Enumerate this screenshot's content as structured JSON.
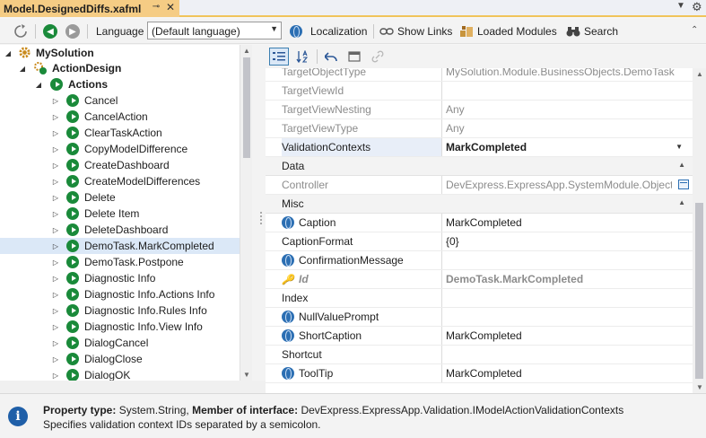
{
  "tab": {
    "title": "Model.DesignedDiffs.xafml",
    "pin_glyph": "⊸",
    "close_glyph": "✕"
  },
  "toolbar": {
    "language_label": "Language",
    "language_value": "(Default language)",
    "localization_label": "Localization",
    "show_links_label": "Show Links",
    "loaded_modules_label": "Loaded Modules",
    "search_label": "Search"
  },
  "tree": {
    "root_label": "MySolution",
    "action_design_label": "ActionDesign",
    "actions_label": "Actions",
    "items": [
      "Cancel",
      "CancelAction",
      "ClearTaskAction",
      "CopyModelDifference",
      "CreateDashboard",
      "CreateModelDifferences",
      "Delete",
      "Delete Item",
      "DeleteDashboard",
      "DemoTask.MarkCompleted",
      "DemoTask.Postpone",
      "Diagnostic Info",
      "Diagnostic Info.Actions Info",
      "Diagnostic Info.Rules Info",
      "Diagnostic Info.View Info",
      "DialogCancel",
      "DialogClose",
      "DialogOK"
    ],
    "selected_index": 9
  },
  "grid": {
    "top_rows": [
      {
        "name": "TargetObjectType",
        "value": "MySolution.Module.BusinessObjects.DemoTask",
        "disabled": true
      },
      {
        "name": "TargetViewId",
        "value": "",
        "disabled": true
      },
      {
        "name": "TargetViewNesting",
        "value": "Any",
        "disabled": true
      },
      {
        "name": "TargetViewType",
        "value": "Any",
        "disabled": true
      },
      {
        "name": "ValidationContexts",
        "value": "MarkCompleted",
        "disabled": false
      }
    ],
    "data_category": "Data",
    "data_rows": [
      {
        "name": "Controller",
        "value": "DevExpress.ExpressApp.SystemModule.ObjectMethodActionsVie"
      }
    ],
    "misc_category": "Misc",
    "misc_rows": [
      {
        "name": "Caption",
        "value": "MarkCompleted",
        "icon": "globe"
      },
      {
        "name": "CaptionFormat",
        "value": "{0}",
        "icon": ""
      },
      {
        "name": "ConfirmationMessage",
        "value": "",
        "icon": "globe"
      },
      {
        "name": "Id",
        "value": "DemoTask.MarkCompleted",
        "icon": "key"
      },
      {
        "name": "Index",
        "value": "",
        "icon": ""
      },
      {
        "name": "NullValuePrompt",
        "value": "",
        "icon": "globe"
      },
      {
        "name": "ShortCaption",
        "value": "MarkCompleted",
        "icon": "globe"
      },
      {
        "name": "Shortcut",
        "value": "",
        "icon": ""
      },
      {
        "name": "ToolTip",
        "value": "MarkCompleted",
        "icon": "globe"
      }
    ]
  },
  "info": {
    "property_type_label": "Property type:",
    "property_type_value": "System.String,",
    "member_label": "Member of interface:",
    "member_value": "DevExpress.ExpressApp.Validation.IModelActionValidationContexts",
    "description": "Specifies validation context IDs separated by a semicolon."
  },
  "colors": {
    "accent": "#f5cc84",
    "selection": "#dbe8f7",
    "action_icon": "#1a8a3a",
    "globe_icon": "#2c6fb3"
  }
}
